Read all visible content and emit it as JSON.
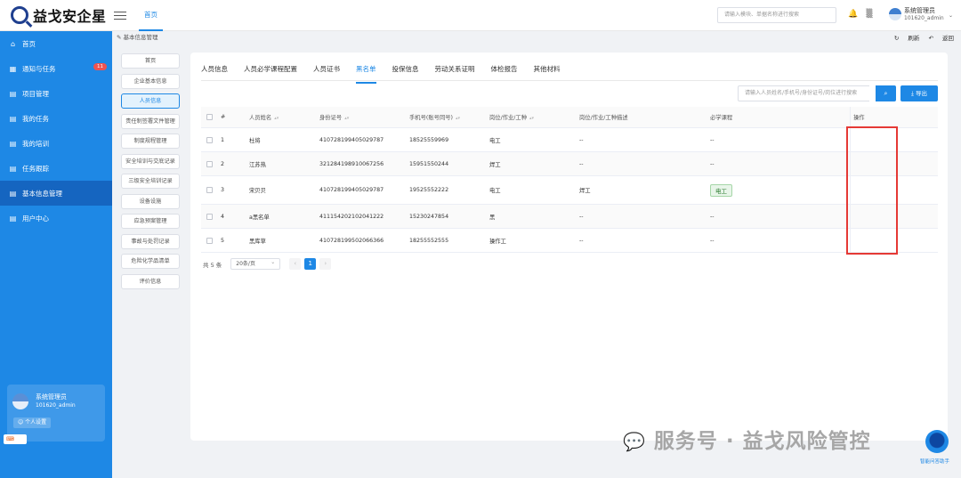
{
  "brand": {
    "name": "益戈安企星"
  },
  "header": {
    "tab": "首页",
    "search_placeholder": "请输入模块、单据名称进行搜索",
    "user_name": "系统管理员",
    "user_id": "101620_admin"
  },
  "sidebar": {
    "items": [
      {
        "label": "首页",
        "icon": "home-icon"
      },
      {
        "label": "通知与任务",
        "icon": "grid-icon",
        "badge": "11"
      },
      {
        "label": "项目管理",
        "icon": "doc-icon"
      },
      {
        "label": "我的任务",
        "icon": "doc-icon"
      },
      {
        "label": "我的培训",
        "icon": "doc-icon"
      },
      {
        "label": "任务跟踪",
        "icon": "doc-icon"
      },
      {
        "label": "基本信息管理",
        "icon": "doc-icon",
        "active": true
      },
      {
        "label": "用户中心",
        "icon": "doc-icon"
      }
    ],
    "user": {
      "name": "系统管理员",
      "id": "101620_admin",
      "settings": "个人设置"
    }
  },
  "breadcrumb": "基本信息管理",
  "actions": {
    "refresh": "刷新",
    "back": "返回"
  },
  "subnav": [
    "首页",
    "企业基本信息",
    "人员信息",
    "责任制签署文件管理",
    "制度规程管理",
    "安全培训与交底记录",
    "三级安全培训记录",
    "设备设施",
    "应急预案管理",
    "事故与处罚记录",
    "危险化学品清单",
    "评价信息"
  ],
  "subnav_active": 2,
  "tabs": [
    "人员信息",
    "人员必学课程配置",
    "人员证书",
    "黑名单",
    "投保信息",
    "劳动关系证明",
    "体检报告",
    "其他材料"
  ],
  "tab_active": 3,
  "toolbar": {
    "search_placeholder": "请输入人员姓名/手机号/身份证号/岗位进行搜索",
    "export_label": "导出"
  },
  "table": {
    "headers": [
      "",
      "#",
      "人员姓名",
      "身份证号",
      "手机号(账号同号)",
      "岗位/作业/工种",
      "岗位/作业/工种描述",
      "必学课程",
      "操作"
    ],
    "rows": [
      {
        "idx": "1",
        "name": "杜将",
        "id": "410728199405029787",
        "phone": "18525559969",
        "job": "电工",
        "desc": "--",
        "course": "--"
      },
      {
        "idx": "2",
        "name": "江苏热",
        "id": "321284198910067256",
        "phone": "15951550244",
        "job": "焊工",
        "desc": "--",
        "course": "--"
      },
      {
        "idx": "3",
        "name": "宋贝贝",
        "id": "410728199405029787",
        "phone": "19525552222",
        "job": "电工",
        "desc": "焊工",
        "course": "电工"
      },
      {
        "idx": "4",
        "name": "a黑名单",
        "id": "411154202102041222",
        "phone": "15230247854",
        "job": "黑",
        "desc": "--",
        "course": "--"
      },
      {
        "idx": "5",
        "name": "黑库草",
        "id": "410728199502066366",
        "phone": "18255552555",
        "job": "操作工",
        "desc": "--",
        "course": "--"
      }
    ]
  },
  "pagination": {
    "total": "共 5 条",
    "page_size": "20条/页",
    "current": "1"
  },
  "watermark": {
    "text": "服务号 · 益戈风险管控",
    "assistant": "智能问答助手"
  },
  "colors": {
    "primary": "#1e88e5",
    "highlight_frame": "#e53935"
  }
}
